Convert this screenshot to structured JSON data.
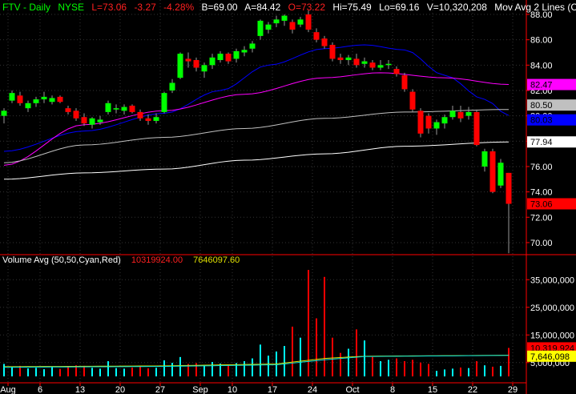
{
  "header": {
    "symbol": "FTV - Daily",
    "exchange": "NYSE",
    "last": "L=73.06",
    "change": "-3.27",
    "pct": "-4.28%",
    "bid": "B=69.00",
    "ask": "A=84.42",
    "open": "O=73.22",
    "high": "Hi=75.49",
    "low": "Lo=69.16",
    "volume": "V=10,320,208",
    "study": "Mov Avg 2 Lines (Close, ..."
  },
  "volume_header": {
    "label": "Volume Avg (50,50,Cyan,Red)",
    "v1": "10319924.00",
    "v2": "7646097.60"
  },
  "colors": {
    "up": "#00ff00",
    "down": "#ff0000",
    "ma_blue": "#0000ff",
    "ma_magenta": "#ff00ff",
    "ma_gray": "#c0c0c0",
    "ma_white": "#ffffff",
    "axis": "#ff0000"
  },
  "chart_data": [
    {
      "type": "candlestick",
      "title": "FTV - Daily",
      "ylim": [
        69,
        89
      ],
      "price_ticks": [
        "88.00",
        "86.00",
        "84.00",
        "82.00",
        "80.00",
        "78.00",
        "76.00",
        "74.00",
        "72.00",
        "70.00"
      ],
      "price_tick_values": [
        88,
        86,
        84,
        82,
        80,
        78,
        76,
        74,
        72,
        70
      ],
      "x_labels": [
        {
          "i": 1,
          "t": "Aug"
        },
        {
          "i": 5,
          "t": "6"
        },
        {
          "i": 10,
          "t": "13"
        },
        {
          "i": 15,
          "t": "20"
        },
        {
          "i": 20,
          "t": "27"
        },
        {
          "i": 25,
          "t": "Sep"
        },
        {
          "i": 29,
          "t": "10"
        },
        {
          "i": 34,
          "t": "17"
        },
        {
          "i": 39,
          "t": "24"
        },
        {
          "i": 44,
          "t": "Oct"
        },
        {
          "i": 49,
          "t": "8"
        },
        {
          "i": 54,
          "t": "15"
        },
        {
          "i": 59,
          "t": "22"
        },
        {
          "i": 64,
          "t": "29"
        }
      ],
      "ohlc": [
        [
          80.0,
          80.6,
          79.4,
          80.4
        ],
        [
          81.2,
          82.0,
          81.0,
          81.8
        ],
        [
          81.6,
          81.9,
          80.8,
          81.0
        ],
        [
          80.6,
          81.2,
          80.3,
          81.0
        ],
        [
          81.0,
          81.5,
          80.7,
          81.3
        ],
        [
          81.3,
          81.9,
          81.0,
          81.5
        ],
        [
          81.1,
          81.6,
          80.9,
          81.4
        ],
        [
          81.5,
          81.6,
          81.0,
          81.1
        ],
        [
          80.6,
          80.8,
          80.1,
          80.3
        ],
        [
          80.4,
          80.6,
          79.6,
          79.8
        ],
        [
          79.9,
          80.2,
          79.2,
          79.4
        ],
        [
          79.3,
          79.9,
          79.0,
          79.8
        ],
        [
          79.5,
          80.0,
          79.3,
          79.7
        ],
        [
          80.3,
          81.2,
          80.1,
          81.0
        ],
        [
          80.5,
          80.9,
          80.2,
          80.6
        ],
        [
          80.4,
          80.9,
          80.1,
          80.7
        ],
        [
          80.8,
          80.9,
          80.2,
          80.3
        ],
        [
          80.3,
          80.5,
          79.6,
          79.8
        ],
        [
          79.8,
          80.1,
          79.3,
          79.6
        ],
        [
          79.6,
          80.2,
          79.4,
          79.9
        ],
        [
          80.3,
          81.9,
          80.2,
          81.8
        ],
        [
          82.0,
          82.9,
          81.8,
          82.6
        ],
        [
          83.0,
          85.0,
          82.9,
          84.9
        ],
        [
          84.5,
          85.0,
          83.8,
          84.3
        ],
        [
          84.4,
          84.6,
          83.5,
          83.8
        ],
        [
          83.5,
          84.2,
          83.0,
          84.0
        ],
        [
          84.0,
          84.9,
          83.7,
          84.6
        ],
        [
          84.4,
          85.1,
          84.2,
          84.9
        ],
        [
          84.9,
          85.0,
          84.1,
          84.3
        ],
        [
          84.5,
          85.3,
          84.2,
          85.1
        ],
        [
          85.0,
          85.5,
          84.7,
          85.2
        ],
        [
          85.3,
          85.9,
          85.0,
          85.7
        ],
        [
          86.3,
          87.6,
          86.0,
          87.5
        ],
        [
          86.8,
          87.4,
          86.5,
          87.2
        ],
        [
          87.3,
          87.9,
          87.0,
          87.6
        ],
        [
          87.5,
          88.0,
          87.1,
          87.9
        ],
        [
          87.4,
          87.6,
          86.5,
          86.8
        ],
        [
          87.2,
          87.8,
          87.0,
          87.6
        ],
        [
          88.0,
          88.3,
          86.6,
          86.8
        ],
        [
          86.6,
          86.9,
          85.8,
          86.0
        ],
        [
          86.1,
          86.3,
          85.3,
          85.5
        ],
        [
          85.6,
          85.8,
          84.3,
          84.5
        ],
        [
          84.6,
          84.9,
          84.1,
          84.4
        ],
        [
          84.4,
          84.8,
          84.0,
          84.6
        ],
        [
          84.5,
          84.9,
          83.8,
          84.0
        ],
        [
          84.1,
          84.6,
          83.8,
          84.3
        ],
        [
          84.2,
          84.4,
          83.6,
          83.8
        ],
        [
          83.8,
          84.4,
          83.6,
          84.0
        ],
        [
          84.0,
          84.4,
          83.7,
          84.1
        ],
        [
          83.7,
          83.9,
          83.1,
          83.3
        ],
        [
          83.2,
          83.4,
          81.9,
          82.1
        ],
        [
          81.9,
          82.1,
          80.3,
          80.5
        ],
        [
          80.4,
          80.6,
          78.3,
          78.6
        ],
        [
          80.0,
          80.2,
          78.6,
          79.0
        ],
        [
          79.0,
          79.7,
          78.5,
          79.5
        ],
        [
          79.4,
          80.1,
          79.0,
          79.9
        ],
        [
          79.9,
          80.8,
          79.7,
          80.4
        ],
        [
          80.3,
          80.8,
          79.5,
          79.8
        ],
        [
          80.0,
          80.7,
          79.7,
          80.3
        ],
        [
          80.3,
          80.5,
          77.6,
          77.7
        ],
        [
          76.0,
          77.4,
          75.6,
          77.2
        ],
        [
          77.2,
          77.4,
          73.9,
          74.0
        ],
        [
          74.5,
          76.6,
          74.3,
          76.3
        ],
        [
          75.5,
          75.5,
          69.16,
          73.06
        ]
      ],
      "ma_lines": [
        {
          "name": "MA blue",
          "color": "#0000ff",
          "last": "80.03",
          "points": [
            [
              0,
              77.2
            ],
            [
              10,
              78.8
            ],
            [
              20,
              80.2
            ],
            [
              27,
              82.0
            ],
            [
              33,
              84.0
            ],
            [
              40,
              85.3
            ],
            [
              45,
              85.6
            ],
            [
              50,
              85.2
            ],
            [
              55,
              83.2
            ],
            [
              60,
              81.3
            ],
            [
              63,
              80.03
            ]
          ]
        },
        {
          "name": "MA magenta",
          "color": "#ff00ff",
          "last": "82.47",
          "points": [
            [
              0,
              76.1
            ],
            [
              10,
              79.3
            ],
            [
              20,
              80.4
            ],
            [
              30,
              81.7
            ],
            [
              40,
              83.0
            ],
            [
              47,
              83.4
            ],
            [
              55,
              83.0
            ],
            [
              63,
              82.47
            ]
          ]
        },
        {
          "name": "MA gray",
          "color": "#c0c0c0",
          "last": "80.50",
          "points": [
            [
              0,
              76.3
            ],
            [
              10,
              77.7
            ],
            [
              20,
              78.3
            ],
            [
              30,
              79.0
            ],
            [
              40,
              79.8
            ],
            [
              50,
              80.3
            ],
            [
              63,
              80.5
            ]
          ]
        },
        {
          "name": "MA white",
          "color": "#ffffff",
          "last": "77.94",
          "points": [
            [
              0,
              75.0
            ],
            [
              10,
              75.5
            ],
            [
              20,
              75.8
            ],
            [
              30,
              76.5
            ],
            [
              40,
              77.0
            ],
            [
              50,
              77.6
            ],
            [
              63,
              77.94
            ]
          ]
        }
      ],
      "last_price": "73.06"
    },
    {
      "type": "bar",
      "title": "Volume Avg (50,50,Cyan,Red)",
      "ylim": [
        0,
        40000000
      ],
      "ticks": [
        "35,000,000",
        "25,000,000",
        "15,000,000",
        "5,000,000"
      ],
      "tick_values": [
        35,
        25,
        15,
        5
      ],
      "volumes_m": [
        4.5,
        3.2,
        3.8,
        2.9,
        3.1,
        2.6,
        3.3,
        2.7,
        3.5,
        4.0,
        3.8,
        3.1,
        2.8,
        5.5,
        3.0,
        2.8,
        3.2,
        3.6,
        2.9,
        3.1,
        5.8,
        4.9,
        7.0,
        4.5,
        4.8,
        4.0,
        5.2,
        4.6,
        4.2,
        4.8,
        5.5,
        6.5,
        11.5,
        7.5,
        9.0,
        11.0,
        18.0,
        14.0,
        38.5,
        21.0,
        36.0,
        14.0,
        8.5,
        10.0,
        17.0,
        13.0,
        7.0,
        5.5,
        6.0,
        6.5,
        5.5,
        6.0,
        5.0,
        4.5,
        2.0,
        2.5,
        2.8,
        3.2,
        3.0,
        5.5,
        4.0,
        3.5,
        3.8,
        10.3
      ],
      "avg_points": [
        [
          0,
          3.5
        ],
        [
          20,
          3.8
        ],
        [
          34,
          4.5
        ],
        [
          40,
          6.5
        ],
        [
          45,
          7.3
        ],
        [
          63,
          7.65
        ]
      ],
      "avg2_points": [
        [
          0,
          3.3
        ],
        [
          20,
          3.6
        ],
        [
          34,
          4.2
        ],
        [
          40,
          6.0
        ],
        [
          45,
          7.2
        ],
        [
          63,
          7.6
        ]
      ],
      "last_volume": "10,319,924",
      "last_avg": "7,646,098"
    }
  ]
}
